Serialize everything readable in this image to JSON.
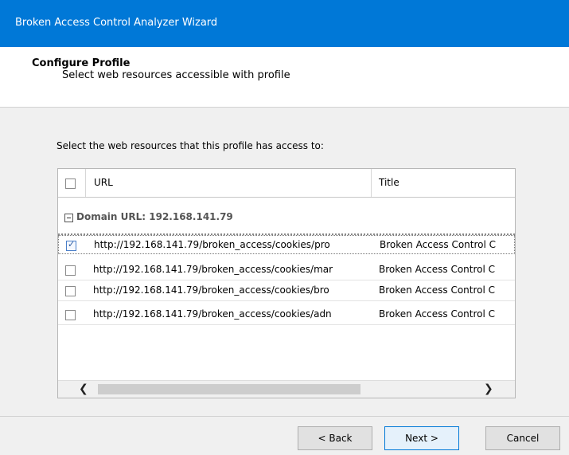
{
  "window": {
    "title": "Broken Access Control Analyzer Wizard"
  },
  "header": {
    "title": "Configure Profile",
    "subtitle": "Select web resources accessible with profile"
  },
  "instruction": "Select the web resources that this profile has access to:",
  "grid": {
    "columns": [
      "URL",
      "Title"
    ],
    "group_label": "Domain URL: 192.168.141.79",
    "rows": [
      {
        "checked": true,
        "url": "http://192.168.141.79/broken_access/cookies/pro",
        "title": "Broken Access Control C"
      },
      {
        "checked": false,
        "url": "http://192.168.141.79/broken_access/cookies/mar",
        "title": "Broken Access Control C"
      },
      {
        "checked": false,
        "url": "http://192.168.141.79/broken_access/cookies/bro",
        "title": "Broken Access Control C"
      },
      {
        "checked": false,
        "url": "http://192.168.141.79/broken_access/cookies/adn",
        "title": "Broken Access Control C"
      }
    ],
    "scroll_left": "❮",
    "scroll_right": "❯"
  },
  "buttons": {
    "back": "< Back",
    "next": "Next >",
    "cancel": "Cancel"
  }
}
